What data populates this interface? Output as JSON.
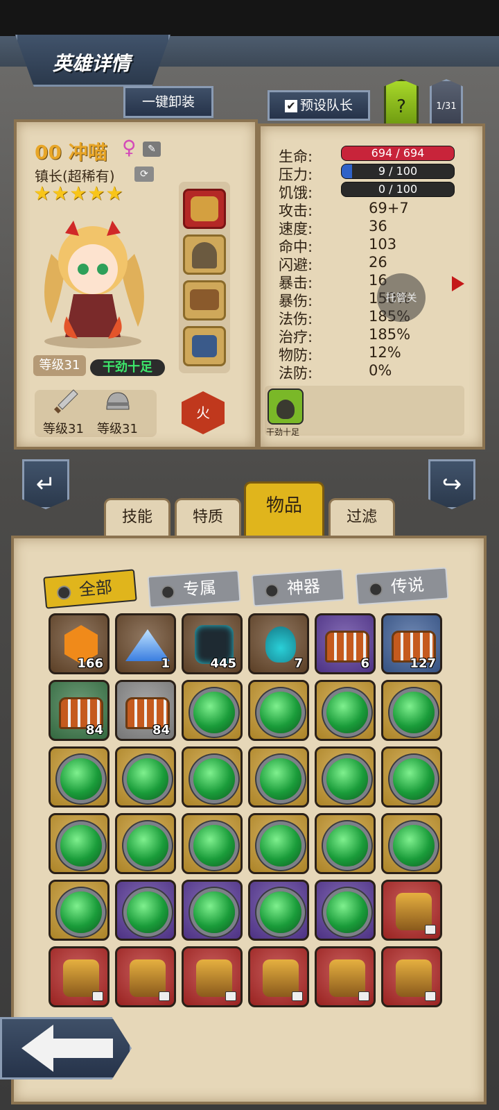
{
  "header": {
    "title": "英雄详情"
  },
  "buttons": {
    "unequip_all": "一键卸装",
    "preset_leader": "预设队长",
    "help": "?",
    "page": "1/31"
  },
  "hero": {
    "name": "00 冲喵",
    "gender_symbol": "♀",
    "class": "镇长(超稀有)",
    "stars": "★★★★★",
    "level": "等级31",
    "mood": "干劲十足",
    "weapon_level": "等级31",
    "armor_level": "等级31",
    "element": "火"
  },
  "stats": {
    "hp": {
      "label": "生命:",
      "value": "694 / 694",
      "fraction": 1.0,
      "color": "#c8243a"
    },
    "stress": {
      "label": "压力:",
      "value": "9 / 100",
      "fraction": 0.09,
      "color": "#2f62c8"
    },
    "hunger": {
      "label": "饥饿:",
      "value": "0 / 100",
      "fraction": 0.0,
      "color": "#2a2a2a"
    },
    "rows": [
      {
        "label": "攻击:",
        "value": "69+7"
      },
      {
        "label": "速度:",
        "value": "36"
      },
      {
        "label": "命中:",
        "value": "103"
      },
      {
        "label": "闪避:",
        "value": "26"
      },
      {
        "label": "暴击:",
        "value": "16"
      },
      {
        "label": "暴伤:",
        "value": "150%"
      },
      {
        "label": "法伤:",
        "value": "185%"
      },
      {
        "label": "治疗:",
        "value": "185%"
      },
      {
        "label": "物防:",
        "value": "12%"
      },
      {
        "label": "法防:",
        "value": "0%"
      }
    ],
    "trait_label": "干劲十足"
  },
  "assist_bubble": "托管关",
  "tabs": [
    "技能",
    "特质",
    "物品",
    "过滤"
  ],
  "active_tab": "物品",
  "filters": [
    "全部",
    "专属",
    "神器",
    "传说"
  ],
  "items": [
    {
      "type": "rune",
      "frame": "brown",
      "count": "166"
    },
    {
      "type": "crystal",
      "frame": "brown",
      "count": "1"
    },
    {
      "type": "stone",
      "frame": "brown",
      "count": "445"
    },
    {
      "type": "potion",
      "frame": "brown",
      "count": "7"
    },
    {
      "type": "chest",
      "frame": "purple",
      "count": "6"
    },
    {
      "type": "chest",
      "frame": "blue",
      "count": "127"
    },
    {
      "type": "chest",
      "frame": "green",
      "count": "84"
    },
    {
      "type": "chest",
      "frame": "gray",
      "count": "84"
    },
    {
      "type": "gem",
      "frame": "gold",
      "count": ""
    },
    {
      "type": "gem",
      "frame": "gold",
      "count": ""
    },
    {
      "type": "gem",
      "frame": "gold",
      "count": ""
    },
    {
      "type": "gem",
      "frame": "gold",
      "count": ""
    },
    {
      "type": "gem",
      "frame": "gold",
      "count": ""
    },
    {
      "type": "gem",
      "frame": "gold",
      "count": ""
    },
    {
      "type": "gem",
      "frame": "gold",
      "count": ""
    },
    {
      "type": "gem",
      "frame": "gold",
      "count": ""
    },
    {
      "type": "gem",
      "frame": "gold",
      "count": ""
    },
    {
      "type": "gem",
      "frame": "gold",
      "count": ""
    },
    {
      "type": "gem",
      "frame": "gold",
      "count": ""
    },
    {
      "type": "gem",
      "frame": "gold",
      "count": ""
    },
    {
      "type": "gem",
      "frame": "gold",
      "count": ""
    },
    {
      "type": "gem",
      "frame": "gold",
      "count": ""
    },
    {
      "type": "gem",
      "frame": "gold",
      "count": ""
    },
    {
      "type": "gem",
      "frame": "gold",
      "count": ""
    },
    {
      "type": "gem",
      "frame": "gold",
      "count": ""
    },
    {
      "type": "gem",
      "frame": "purple",
      "count": ""
    },
    {
      "type": "gem",
      "frame": "purple",
      "count": ""
    },
    {
      "type": "gem",
      "frame": "purple",
      "count": ""
    },
    {
      "type": "gem",
      "frame": "purple",
      "count": ""
    },
    {
      "type": "armor",
      "frame": "red",
      "count": ""
    },
    {
      "type": "gauntlet",
      "frame": "red",
      "count": ""
    },
    {
      "type": "pistol",
      "frame": "red",
      "count": ""
    },
    {
      "type": "helmet",
      "frame": "red",
      "count": ""
    },
    {
      "type": "crossbow",
      "frame": "red",
      "count": ""
    },
    {
      "type": "sword",
      "frame": "red",
      "count": ""
    },
    {
      "type": "mask",
      "frame": "red",
      "count": ""
    }
  ],
  "frame_colors": {
    "brown": "#6b4a2c",
    "purple": "#5a3a9a",
    "blue": "#3e5f98",
    "green": "#3c7a4a",
    "gray": "#8a8a8a",
    "gold": "#c99a2e",
    "red": "#b42826"
  }
}
